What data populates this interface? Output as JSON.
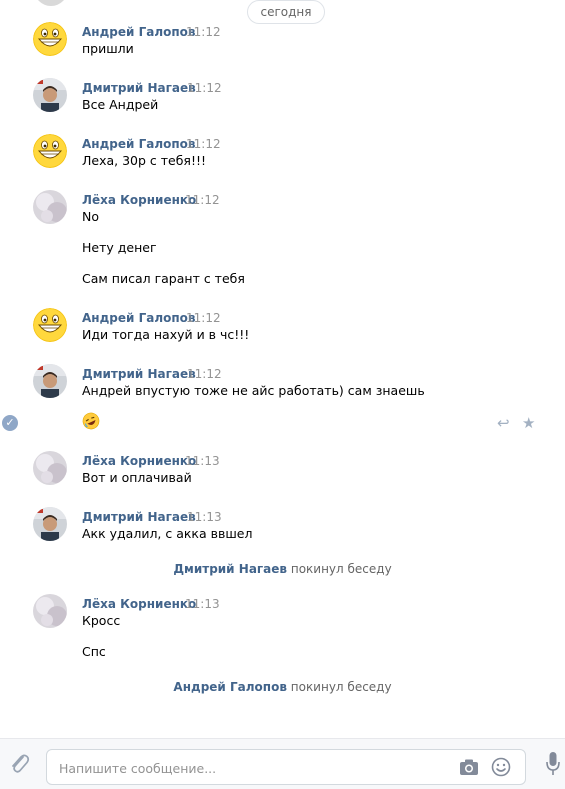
{
  "date_divider": "сегодня",
  "messages": [
    {
      "author": "Андрей Галопов",
      "time": "11:12",
      "lines": [
        "пришли"
      ],
      "avatar": "smiley-avatar"
    },
    {
      "author": "Дмитрий Нагаев",
      "time": "11:12",
      "lines": [
        "Все Андрей"
      ],
      "avatar": "photo-avatar"
    },
    {
      "author": "Андрей Галопов",
      "time": "11:12",
      "lines": [
        "Леха, 30р с тебя!!!"
      ],
      "avatar": "smiley-avatar"
    },
    {
      "author": "Лёха Корниенко",
      "time": "11:12",
      "lines": [
        "No",
        "Нету денег",
        "Сам писал гарант с тебя"
      ],
      "avatar": "blur-avatar"
    },
    {
      "author": "Андрей Галопов",
      "time": "11:12",
      "lines": [
        "Иди тогда нахуй и в чс!!!"
      ],
      "avatar": "smiley-avatar"
    },
    {
      "author": "Дмитрий Нагаев",
      "time": "11:12",
      "lines": [
        "Андрей впустую тоже не айс работать) сам знаешь"
      ],
      "avatar": "photo-avatar"
    },
    {
      "author": "Лёха Корниенко",
      "time": "11:13",
      "lines": [
        "Вот и оплачивай"
      ],
      "avatar": "blur-avatar"
    },
    {
      "author": "Дмитрий Нагаев",
      "time": "11:13",
      "lines": [
        "Акк удалил, с акка ввшел"
      ],
      "avatar": "photo-avatar"
    },
    {
      "author": "Лёха Корниенко",
      "time": "11:13",
      "lines": [
        "Кросс",
        "Спс"
      ],
      "avatar": "blur-avatar"
    }
  ],
  "service_messages": [
    {
      "name": "Дмитрий Нагаев",
      "text": "покинул беседу"
    },
    {
      "name": "Андрей Галопов",
      "text": "покинул беседу"
    }
  ],
  "emoji_message": "rofl-emoji",
  "hover_actions": [
    "reply-icon",
    "star-icon"
  ],
  "composer": {
    "placeholder": "Напишите сообщение..."
  },
  "colors": {
    "author": "#42648b",
    "time": "#939393",
    "service": "#656565",
    "accent": "#8fa7c7"
  }
}
